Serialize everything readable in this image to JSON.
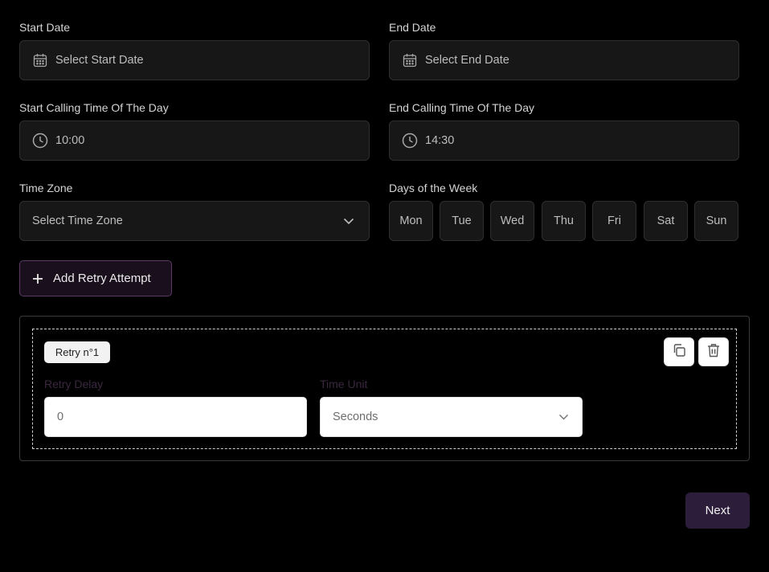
{
  "dates": {
    "start_label": "Start Date",
    "start_placeholder": "Select Start Date",
    "end_label": "End Date",
    "end_placeholder": "Select End Date"
  },
  "times": {
    "start_label": "Start Calling Time Of The Day",
    "start_value": "10:00",
    "end_label": "End Calling Time Of The Day",
    "end_value": "14:30"
  },
  "timezone": {
    "label": "Time Zone",
    "placeholder": "Select Time Zone"
  },
  "days": {
    "label": "Days of the Week",
    "items": [
      "Mon",
      "Tue",
      "Wed",
      "Thu",
      "Fri",
      "Sat",
      "Sun"
    ]
  },
  "add_retry_label": "Add Retry Attempt",
  "retry": {
    "tag": "Retry n°1",
    "delay_label": "Retry Delay",
    "delay_value": "0",
    "unit_label": "Time Unit",
    "unit_value": "Seconds"
  },
  "next_label": "Next",
  "colors": {
    "accent": "#2c1d3a",
    "accent_border": "#5b3a63",
    "field_bg": "#171717"
  }
}
